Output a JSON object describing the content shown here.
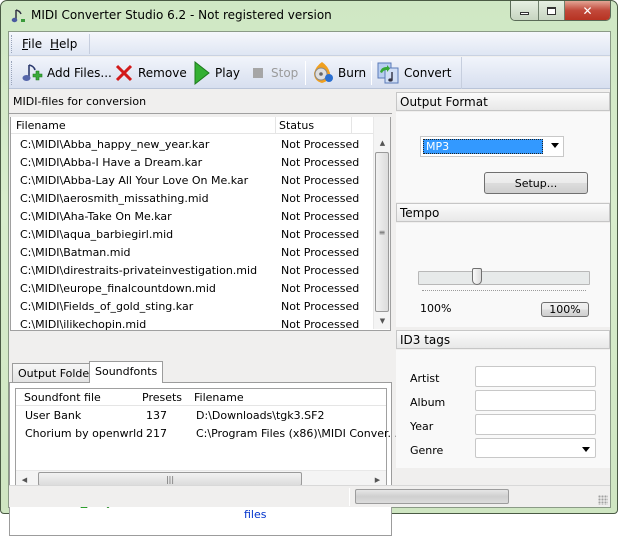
{
  "window": {
    "title": "MIDI Converter Studio 6.2 - Not registered version",
    "caption_buttons": {
      "minimize": "minimize-icon",
      "maximize": "maximize-icon",
      "close": "close-icon"
    }
  },
  "menu": {
    "items": [
      {
        "label": "File",
        "mnemonic": "F"
      },
      {
        "label": "Help",
        "mnemonic": "H"
      }
    ]
  },
  "toolbar": {
    "buttons": [
      {
        "label": "Add Files...",
        "icon": "add-music-icon",
        "enabled": true
      },
      {
        "label": "Remove",
        "icon": "red-x-icon",
        "enabled": true
      },
      {
        "label": "Play",
        "icon": "play-icon",
        "enabled": true
      },
      {
        "label": "Stop",
        "icon": "stop-icon",
        "enabled": false
      },
      {
        "label": "Burn",
        "icon": "burn-disc-icon",
        "enabled": true
      },
      {
        "label": "Convert",
        "icon": "convert-icon",
        "enabled": true
      }
    ]
  },
  "files_panel": {
    "title": "MIDI-files for conversion",
    "columns": [
      "Filename",
      "Status"
    ],
    "rows": [
      {
        "filename": "C:\\MIDI\\Abba_happy_new_year.kar",
        "status": "Not Processed"
      },
      {
        "filename": "C:\\MIDI\\Abba-I Have a Dream.kar",
        "status": "Not Processed"
      },
      {
        "filename": "C:\\MIDI\\Abba-Lay All Your Love On Me.kar",
        "status": "Not Processed"
      },
      {
        "filename": "C:\\MIDI\\aerosmith_missathing.mid",
        "status": "Not Processed"
      },
      {
        "filename": "C:\\MIDI\\Aha-Take On Me.kar",
        "status": "Not Processed"
      },
      {
        "filename": "C:\\MIDI\\aqua_barbiegirl.mid",
        "status": "Not Processed"
      },
      {
        "filename": "C:\\MIDI\\Batman.mid",
        "status": "Not Processed"
      },
      {
        "filename": "C:\\MIDI\\direstraits-privateinvestigation.mid",
        "status": "Not Processed"
      },
      {
        "filename": "C:\\MIDI\\europe_finalcountdown.mid",
        "status": "Not Processed"
      },
      {
        "filename": "C:\\MIDI\\Fields_of_gold_sting.kar",
        "status": "Not Processed"
      },
      {
        "filename": "C:\\MIDI\\ilikechopin.mid",
        "status": "Not Processed"
      }
    ]
  },
  "tabs": [
    {
      "label": "Output Folder",
      "active": false
    },
    {
      "label": "Soundfonts",
      "active": true
    }
  ],
  "soundfonts": {
    "columns": [
      "Soundfont file",
      "Presets",
      "Filename"
    ],
    "rows": [
      {
        "name": "User Bank",
        "presets": "137",
        "filename": "D:\\Downloads\\tgk3.SF2"
      },
      {
        "name": "Chorium by openwrld",
        "presets": "217",
        "filename": "C:\\Program Files (x86)\\MIDI Conver..."
      }
    ],
    "tools": [
      "add-icon",
      "remove-icon",
      "move-up-icon",
      "move-down-icon"
    ],
    "recent_label": "Recent soundfonts",
    "download_link": "Download free soundfont files"
  },
  "output_format": {
    "title": "Output Format",
    "selected": "MP3",
    "setup_label": "Setup..."
  },
  "tempo": {
    "title": "Tempo",
    "value_label": "100%",
    "reset_label": "100%",
    "slider_fraction": 0.25
  },
  "id3": {
    "title": "ID3 tags",
    "fields": [
      {
        "label": "Artist",
        "value": ""
      },
      {
        "label": "Album",
        "value": ""
      },
      {
        "label": "Year",
        "value": ""
      },
      {
        "label": "Genre",
        "value": ""
      }
    ]
  },
  "status": {
    "progress": 0
  }
}
